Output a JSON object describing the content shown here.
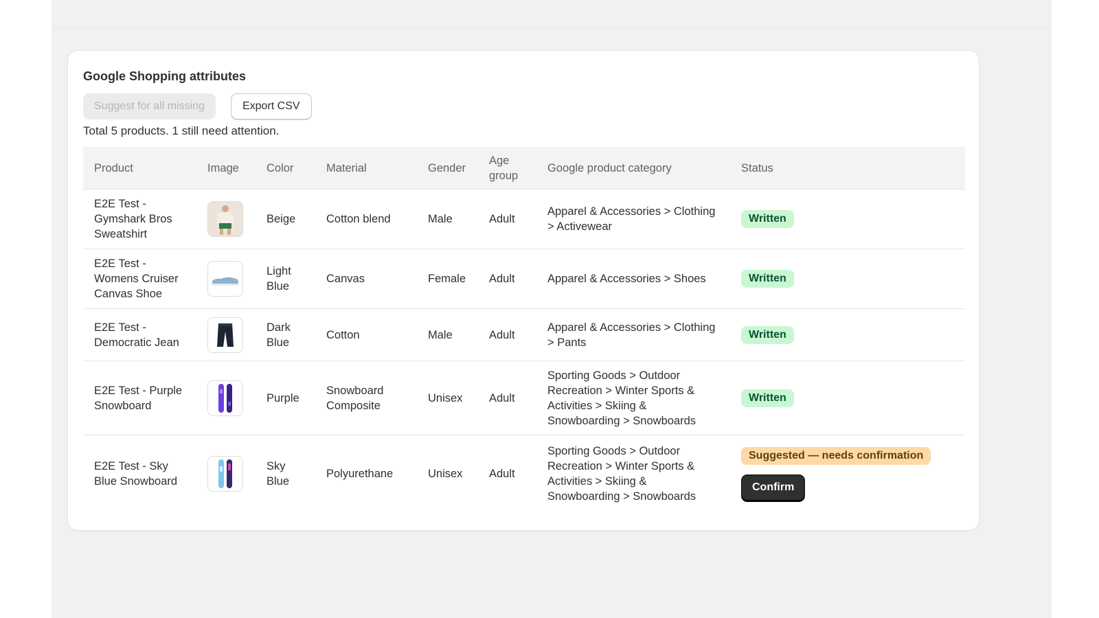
{
  "card": {
    "title": "Google Shopping attributes",
    "suggest_all_label": "Suggest for all missing",
    "export_label": "Export CSV",
    "summary": "Total 5 products. 1 still need attention."
  },
  "table": {
    "headers": {
      "product": "Product",
      "image": "Image",
      "color": "Color",
      "material": "Material",
      "gender": "Gender",
      "age_group": "Age group",
      "category": "Google product category",
      "status": "Status"
    },
    "rows": [
      {
        "product": "E2E Test - Gymshark Bros Sweatshirt",
        "image": "sweatshirt-product-image",
        "color": "Beige",
        "material": "Cotton blend",
        "gender": "Male",
        "age_group": "Adult",
        "category": "Apparel & Accessories > Clothing > Activewear",
        "status": "Written"
      },
      {
        "product": "E2E Test - Womens Cruiser Canvas Shoe",
        "image": "shoe-product-image",
        "color": "Light Blue",
        "material": "Canvas",
        "gender": "Female",
        "age_group": "Adult",
        "category": "Apparel & Accessories > Shoes",
        "status": "Written"
      },
      {
        "product": "E2E Test - Democratic Jean",
        "image": "jeans-product-image",
        "color": "Dark Blue",
        "material": "Cotton",
        "gender": "Male",
        "age_group": "Adult",
        "category": "Apparel & Accessories > Clothing > Pants",
        "status": "Written"
      },
      {
        "product": "E2E Test - Purple Snowboard",
        "image": "purple-snowboard-product-image",
        "color": "Purple",
        "material": "Snowboard Composite",
        "gender": "Unisex",
        "age_group": "Adult",
        "category": "Sporting Goods > Outdoor Recreation > Winter Sports & Activities > Skiing & Snowboarding > Snowboards",
        "status": "Written"
      },
      {
        "product": "E2E Test - Sky Blue Snowboard",
        "image": "sky-blue-snowboard-product-image",
        "color": "Sky Blue",
        "material": "Polyurethane",
        "gender": "Unisex",
        "age_group": "Adult",
        "category": "Sporting Goods > Outdoor Recreation > Winter Sports & Activities > Skiing & Snowboarding > Snowboards",
        "status": "Suggested — needs confirmation",
        "action_label": "Confirm"
      }
    ]
  },
  "colors": {
    "success_badge_bg": "#c8f7d2",
    "attention_badge_bg": "#ffd8a8",
    "primary_button": "#303030",
    "page_background": "#f1f1f1"
  }
}
